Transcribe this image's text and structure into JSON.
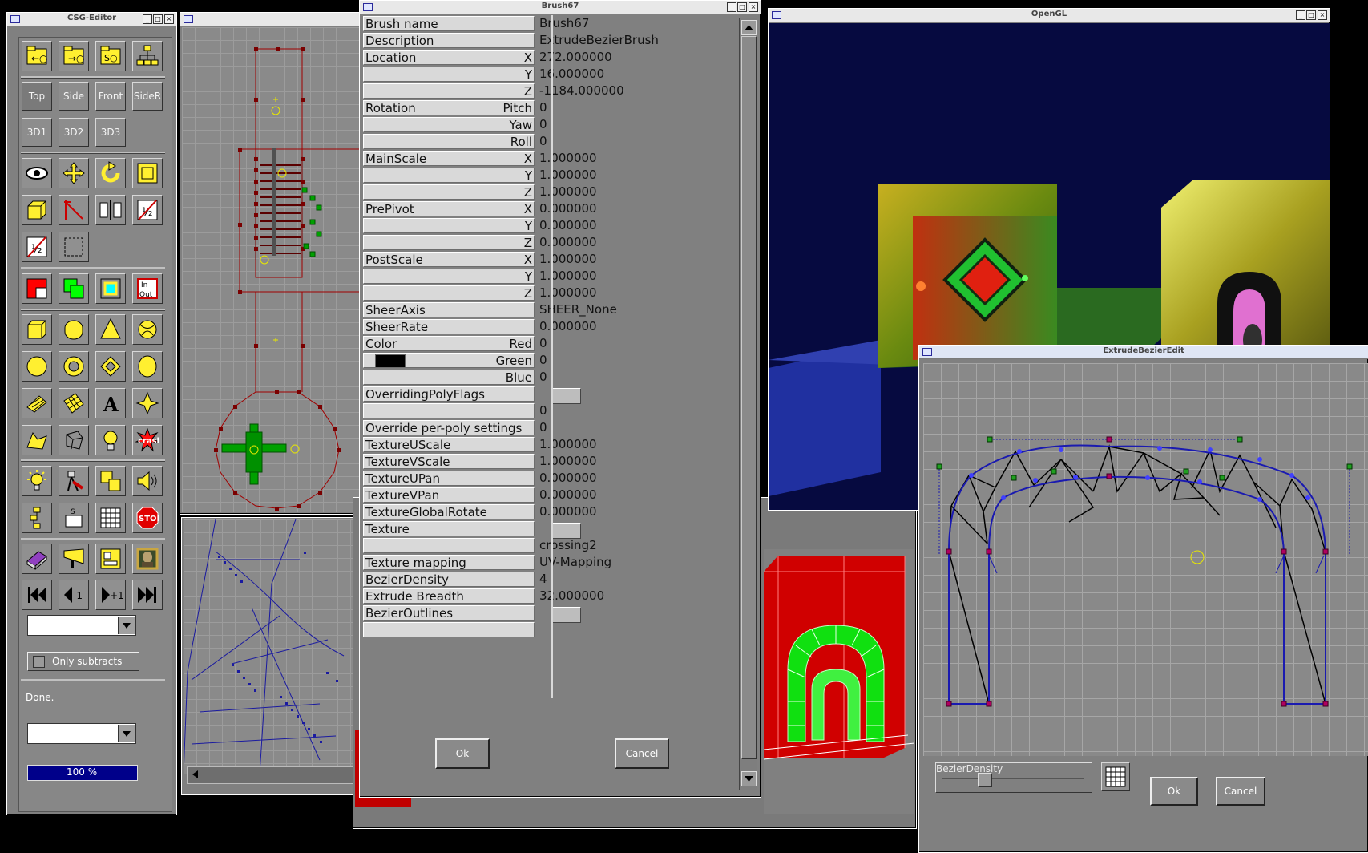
{
  "csg": {
    "title": "CSG-Editor",
    "view_buttons": [
      "Top",
      "Side",
      "Front",
      "SideR"
    ],
    "view3d_buttons": [
      "3D1",
      "3D2",
      "3D3"
    ],
    "only_subtracts": "Only subtracts",
    "status": "Done.",
    "progress": "100 %",
    "progress_value": 100
  },
  "brush": {
    "title": "Brush67",
    "rows": [
      {
        "label": "Brush name",
        "axis": "",
        "value": "Brush67"
      },
      {
        "label": "Description",
        "axis": "",
        "value": "ExtrudeBezierBrush"
      },
      {
        "label": "Location",
        "axis": "X",
        "value": "272.000000"
      },
      {
        "label": "",
        "axis": "Y",
        "value": "16.000000"
      },
      {
        "label": "",
        "axis": "Z",
        "value": "-1184.000000"
      },
      {
        "label": "Rotation",
        "axis": "Pitch",
        "value": "0"
      },
      {
        "label": "",
        "axis": "Yaw",
        "value": "0"
      },
      {
        "label": "",
        "axis": "Roll",
        "value": "0"
      },
      {
        "label": "MainScale",
        "axis": "X",
        "value": "1.000000"
      },
      {
        "label": "",
        "axis": "Y",
        "value": "1.000000"
      },
      {
        "label": "",
        "axis": "Z",
        "value": "1.000000"
      },
      {
        "label": "PrePivot",
        "axis": "X",
        "value": "0.000000"
      },
      {
        "label": "",
        "axis": "Y",
        "value": "0.000000"
      },
      {
        "label": "",
        "axis": "Z",
        "value": "0.000000"
      },
      {
        "label": "PostScale",
        "axis": "X",
        "value": "1.000000"
      },
      {
        "label": "",
        "axis": "Y",
        "value": "1.000000"
      },
      {
        "label": "",
        "axis": "Z",
        "value": "1.000000"
      },
      {
        "label": "SheerAxis",
        "axis": "",
        "value": "SHEER_None"
      },
      {
        "label": "SheerRate",
        "axis": "",
        "value": "0.000000"
      },
      {
        "label": "Color",
        "axis": "Red",
        "value": "0"
      },
      {
        "label": "",
        "axis": "Green",
        "value": "0",
        "swatch": "#000000"
      },
      {
        "label": "",
        "axis": "Blue",
        "value": "0"
      },
      {
        "label": "OverridingPolyFlags",
        "axis": "",
        "value": "",
        "box": true
      },
      {
        "label": "",
        "axis": "",
        "value": "0",
        "blank": true
      },
      {
        "label": "Override per-poly settings",
        "axis": "",
        "value": "0"
      },
      {
        "label": "TextureUScale",
        "axis": "",
        "value": "1.000000"
      },
      {
        "label": "TextureVScale",
        "axis": "",
        "value": "1.000000"
      },
      {
        "label": "TextureUPan",
        "axis": "",
        "value": "0.000000"
      },
      {
        "label": "TextureVPan",
        "axis": "",
        "value": "0.000000"
      },
      {
        "label": "TextureGlobalRotate",
        "axis": "",
        "value": "0.000000"
      },
      {
        "label": "Texture",
        "axis": "",
        "value": "",
        "box": true
      },
      {
        "label": "",
        "axis": "",
        "value": "crossing2",
        "blank": true
      },
      {
        "label": "Texture mapping",
        "axis": "",
        "value": "UV-Mapping"
      },
      {
        "label": "BezierDensity",
        "axis": "",
        "value": "4"
      },
      {
        "label": "Extrude Breadth",
        "axis": "",
        "value": "32.000000"
      },
      {
        "label": "BezierOutlines",
        "axis": "",
        "value": "",
        "box": true
      },
      {
        "label": "",
        "axis": "",
        "value": "",
        "blank": true
      }
    ],
    "ok": "Ok",
    "cancel": "Cancel"
  },
  "opengl": {
    "title": "OpenGL"
  },
  "bezier": {
    "title": "ExtrudeBezierEdit",
    "density_label": "BezierDensity",
    "ok": "Ok",
    "cancel": "Cancel"
  }
}
